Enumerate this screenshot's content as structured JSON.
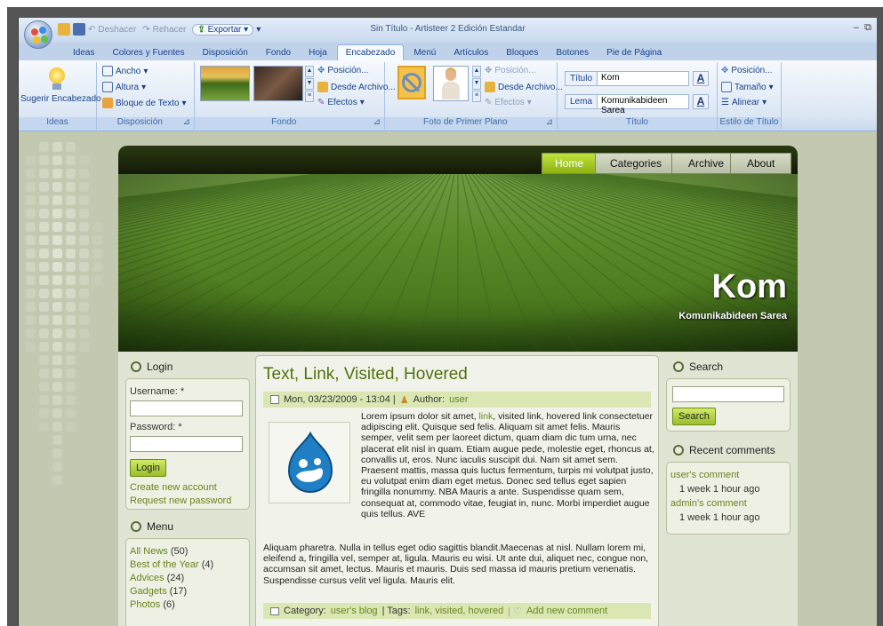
{
  "app": {
    "title": "Sin Título - Artisteer 2 Edición Estandar",
    "qat": {
      "undo": "Deshacer",
      "redo": "Rehacer",
      "export": "Exportar"
    }
  },
  "ribbon_tabs": [
    "Ideas",
    "Colores y Fuentes",
    "Disposición",
    "Fondo",
    "Hoja",
    "Encabezado",
    "Menú",
    "Artículos",
    "Bloques",
    "Botones",
    "Pie de Página"
  ],
  "active_tab": "Encabezado",
  "ribbon": {
    "ideas": {
      "button": "Sugerir Encabezado",
      "label": "Ideas"
    },
    "disposicion": {
      "width": "Ancho",
      "height": "Altura",
      "textblock": "Bloque de Texto",
      "label": "Disposición"
    },
    "fondo": {
      "position": "Posición...",
      "from_file": "Desde Archivo...",
      "effects": "Efectos",
      "label": "Fondo"
    },
    "foreground": {
      "position": "Posición...",
      "from_file": "Desde Archivo...",
      "effects": "Efectos",
      "label": "Foto de Primer Plano"
    },
    "titulo": {
      "title_label": "Título",
      "title_value": "Kom",
      "slogan_label": "Lema",
      "slogan_value": "Komunikabideen Sarea",
      "label": "Título"
    },
    "estilo": {
      "position": "Posición...",
      "size": "Tamaño",
      "align": "Alinear",
      "label": "Estilo de Título"
    }
  },
  "site": {
    "nav": [
      "Home",
      "Categories",
      "Archive",
      "About"
    ],
    "name": "Kom",
    "slogan": "Komunikabideen Sarea",
    "login": {
      "title": "Login",
      "username": "Username: *",
      "password": "Password: *",
      "button": "Login",
      "create": "Create new account",
      "request": "Request new password"
    },
    "menu": {
      "title": "Menu",
      "items": [
        {
          "label": "All News",
          "count": "(50)"
        },
        {
          "label": "Best of the Year",
          "count": "(4)"
        },
        {
          "label": "Advices",
          "count": "(24)"
        },
        {
          "label": "Gadgets",
          "count": "(17)"
        },
        {
          "label": "Photos",
          "count": "(6)"
        }
      ]
    },
    "article": {
      "title": "Text, Link, Visited, Hovered",
      "date": "Mon, 03/23/2009 - 13:04 |",
      "author_label": "Author:",
      "author": "user",
      "p1_start": "Lorem ipsum dolor sit amet, ",
      "p1_link": "link",
      "p1_rest": ", visited link, hovered link consectetuer adipiscing elit. Quisque sed felis. Aliquam sit amet felis. Mauris semper, velit sem per laoreet dictum, quam diam dic tum urna, nec placerat elit nisl in quam. Etiam augue pede, molestie eget, rhoncus at, convallis ut, eros. Nunc iaculis suscipit dui. Nam sit amet sem. Praesent mattis, massa quis luctus fermentum, turpis mi volutpat justo, eu volutpat enim diam eget metus. Donec sed tellus eget sapien fringilla nonummy. NBA Mauris a ante. Suspendisse quam sem, consequat at, commodo vitae, feugiat in, nunc. Morbi imperdiet augue quis tellus. AVE",
      "p2": "Aliquam pharetra. Nulla in tellus eget odio sagittis blandit.Maecenas at nisl. Nullam lorem mi, eleifend a, fringilla vel, semper at, ligula. Mauris eu wisi. Ut ante dui, aliquet nec, congue non, accumsan sit amet, lectus. Mauris et mauris. Duis sed massa id mauris pretium venenatis. Suspendisse cursus velit vel ligula. Mauris elit.",
      "category_label": "Category:",
      "category": "user's blog",
      "tags_label": "| Tags:",
      "tags": "link, visited, hovered",
      "comment": "Add new comment"
    },
    "search": {
      "title": "Search",
      "button": "Search"
    },
    "recent": {
      "title": "Recent comments",
      "items": [
        {
          "link": "user's comment",
          "time": "1 week 1 hour ago"
        },
        {
          "link": "admin's comment",
          "time": "1 week 1 hour ago"
        }
      ]
    }
  }
}
